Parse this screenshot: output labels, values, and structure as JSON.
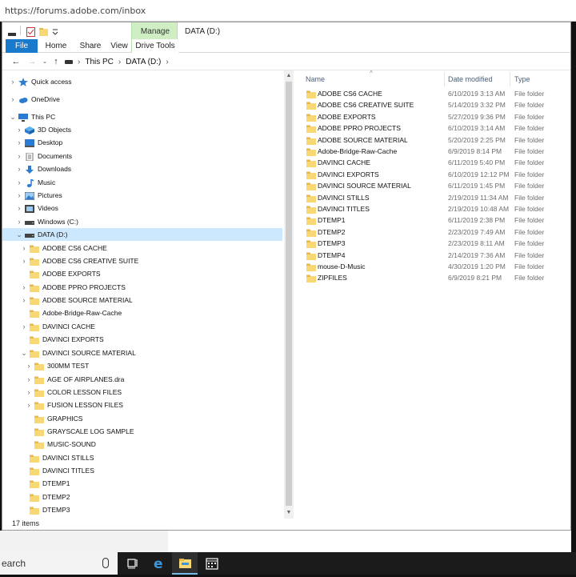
{
  "browser": {
    "url": "https://forums.adobe.com/inbox"
  },
  "ribbon": {
    "tabs": [
      "File",
      "Home",
      "Share",
      "View"
    ],
    "manage_context": "Manage",
    "manage_tab": "Drive Tools",
    "title": "DATA (D:)"
  },
  "address": {
    "crumbs": [
      "This PC",
      "DATA (D:)"
    ]
  },
  "nav_tree": [
    {
      "label": "Quick access",
      "icon": "star-icon",
      "level": 0,
      "chev": "›"
    },
    {
      "label": "OneDrive",
      "icon": "cloud-icon",
      "level": 0,
      "chev": "›"
    },
    {
      "label": "This PC",
      "icon": "computer-icon",
      "level": 0,
      "chev": "⌄"
    },
    {
      "label": "3D Objects",
      "icon": "cube-icon",
      "level": 1,
      "chev": "›"
    },
    {
      "label": "Desktop",
      "icon": "desktop-icon",
      "level": 1,
      "chev": "›"
    },
    {
      "label": "Documents",
      "icon": "document-icon",
      "level": 1,
      "chev": "›"
    },
    {
      "label": "Downloads",
      "icon": "download-icon",
      "level": 1,
      "chev": "›"
    },
    {
      "label": "Music",
      "icon": "music-icon",
      "level": 1,
      "chev": "›"
    },
    {
      "label": "Pictures",
      "icon": "pictures-icon",
      "level": 1,
      "chev": "›"
    },
    {
      "label": "Videos",
      "icon": "video-icon",
      "level": 1,
      "chev": "›"
    },
    {
      "label": "Windows (C:)",
      "icon": "drive-icon",
      "level": 1,
      "chev": "›"
    },
    {
      "label": "DATA (D:)",
      "icon": "drive-icon",
      "level": 1,
      "chev": "⌄",
      "selected": true
    },
    {
      "label": "ADOBE CS6 CACHE",
      "icon": "folder-icon",
      "level": 2,
      "chev": "›"
    },
    {
      "label": "ADOBE CS6 CREATIVE SUITE",
      "icon": "folder-icon",
      "level": 2,
      "chev": "›"
    },
    {
      "label": "ADOBE EXPORTS",
      "icon": "folder-icon",
      "level": 2,
      "chev": ""
    },
    {
      "label": "ADOBE PPRO PROJECTS",
      "icon": "folder-icon",
      "level": 2,
      "chev": "›"
    },
    {
      "label": "ADOBE SOURCE MATERIAL",
      "icon": "folder-icon",
      "level": 2,
      "chev": "›"
    },
    {
      "label": "Adobe-Bridge-Raw-Cache",
      "icon": "folder-icon",
      "level": 2,
      "chev": ""
    },
    {
      "label": "DAVINCI CACHE",
      "icon": "folder-icon",
      "level": 2,
      "chev": "›"
    },
    {
      "label": "DAVINCI EXPORTS",
      "icon": "folder-icon",
      "level": 2,
      "chev": ""
    },
    {
      "label": "DAVINCI SOURCE MATERIAL",
      "icon": "folder-icon",
      "level": 2,
      "chev": "⌄"
    },
    {
      "label": "300MM TEST",
      "icon": "folder-icon",
      "level": 3,
      "chev": "›"
    },
    {
      "label": "AGE OF AIRPLANES.dra",
      "icon": "folder-icon",
      "level": 3,
      "chev": "›"
    },
    {
      "label": "COLOR LESSON FILES",
      "icon": "folder-icon",
      "level": 3,
      "chev": "›"
    },
    {
      "label": "FUSION LESSON FILES",
      "icon": "folder-icon",
      "level": 3,
      "chev": "›"
    },
    {
      "label": "GRAPHICS",
      "icon": "folder-icon",
      "level": 3,
      "chev": ""
    },
    {
      "label": "GRAYSCALE LOG SAMPLE",
      "icon": "folder-icon",
      "level": 3,
      "chev": ""
    },
    {
      "label": "MUSIC-SOUND",
      "icon": "folder-icon",
      "level": 3,
      "chev": ""
    },
    {
      "label": "DAVINCI STILLS",
      "icon": "folder-icon",
      "level": 2,
      "chev": ""
    },
    {
      "label": "DAVINCI TITLES",
      "icon": "folder-icon",
      "level": 2,
      "chev": ""
    },
    {
      "label": "DTEMP1",
      "icon": "folder-icon",
      "level": 2,
      "chev": ""
    },
    {
      "label": "DTEMP2",
      "icon": "folder-icon",
      "level": 2,
      "chev": ""
    },
    {
      "label": "DTEMP3",
      "icon": "folder-icon",
      "level": 2,
      "chev": ""
    }
  ],
  "file_list": {
    "columns": [
      "Name",
      "Date modified",
      "Type"
    ],
    "rows": [
      {
        "name": "ADOBE CS6 CACHE",
        "date": "6/10/2019 3:13 AM",
        "type": "File folder"
      },
      {
        "name": "ADOBE CS6 CREATIVE SUITE",
        "date": "5/14/2019 3:32 PM",
        "type": "File folder"
      },
      {
        "name": "ADOBE EXPORTS",
        "date": "5/27/2019 9:36 PM",
        "type": "File folder"
      },
      {
        "name": "ADOBE PPRO PROJECTS",
        "date": "6/10/2019 3:14 AM",
        "type": "File folder"
      },
      {
        "name": "ADOBE SOURCE MATERIAL",
        "date": "5/20/2019 2:25 PM",
        "type": "File folder"
      },
      {
        "name": "Adobe-Bridge-Raw-Cache",
        "date": "6/9/2019 8:14 PM",
        "type": "File folder"
      },
      {
        "name": "DAVINCI CACHE",
        "date": "6/11/2019 5:40 PM",
        "type": "File folder"
      },
      {
        "name": "DAVINCI EXPORTS",
        "date": "6/10/2019 12:12 PM",
        "type": "File folder"
      },
      {
        "name": "DAVINCI SOURCE MATERIAL",
        "date": "6/11/2019 1:45 PM",
        "type": "File folder"
      },
      {
        "name": "DAVINCI STILLS",
        "date": "2/19/2019 11:34 AM",
        "type": "File folder"
      },
      {
        "name": "DAVINCI TITLES",
        "date": "2/19/2019 10:48 AM",
        "type": "File folder"
      },
      {
        "name": "DTEMP1",
        "date": "6/11/2019 2:38 PM",
        "type": "File folder"
      },
      {
        "name": "DTEMP2",
        "date": "2/23/2019 7:49 AM",
        "type": "File folder"
      },
      {
        "name": "DTEMP3",
        "date": "2/23/2019 8:11 AM",
        "type": "File folder"
      },
      {
        "name": "DTEMP4",
        "date": "2/14/2019 7:36 AM",
        "type": "File folder"
      },
      {
        "name": "mouse-D-Music",
        "date": "4/30/2019 1:20 PM",
        "type": "File folder"
      },
      {
        "name": "ZIPFILES",
        "date": "6/9/2019 8:21 PM",
        "type": "File folder"
      }
    ]
  },
  "status": {
    "count": "17 items"
  },
  "taskbar": {
    "search_text": "earch"
  },
  "colors": {
    "accent": "#1979ca",
    "selection": "#cce8ff",
    "manage": "#cfeec4",
    "folder": "#f8d775"
  }
}
